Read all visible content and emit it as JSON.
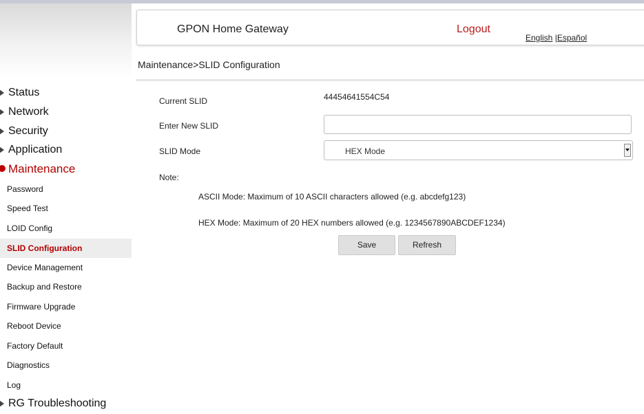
{
  "header": {
    "title": "GPON Home Gateway",
    "logout": "Logout",
    "lang_english": "English",
    "lang_separator": "|",
    "lang_spanish": "Español"
  },
  "breadcrumb": "Maintenance>SLID Configuration",
  "sidebar": {
    "categories": [
      {
        "label": "Status"
      },
      {
        "label": "Network"
      },
      {
        "label": "Security"
      },
      {
        "label": "Application"
      },
      {
        "label": "Maintenance",
        "active": true
      },
      {
        "label": "RG Troubleshooting"
      }
    ],
    "maintenance_items": [
      {
        "label": "Password"
      },
      {
        "label": "Speed Test"
      },
      {
        "label": "LOID Config"
      },
      {
        "label": "SLID Configuration",
        "selected": true
      },
      {
        "label": "Device Management"
      },
      {
        "label": "Backup and Restore"
      },
      {
        "label": "Firmware Upgrade"
      },
      {
        "label": "Reboot Device"
      },
      {
        "label": "Factory Default"
      },
      {
        "label": "Diagnostics"
      },
      {
        "label": "Log"
      }
    ]
  },
  "form": {
    "current_slid_label": "Current SLID",
    "current_slid_value": "44454641554C54",
    "new_slid_label": "Enter New SLID",
    "new_slid_value": "",
    "slid_mode_label": "SLID Mode",
    "slid_mode_value": "HEX Mode",
    "note_label": "Note:",
    "note_ascii": "ASCII Mode: Maximum of 10 ASCII characters allowed (e.g. abcdefg123)",
    "note_hex": "HEX Mode: Maximum of 20 HEX numbers allowed (e.g. 1234567890ABCDEF1234)"
  },
  "buttons": {
    "save": "Save",
    "refresh": "Refresh"
  },
  "colors": {
    "accent_red": "#b00000",
    "logout_red": "#b71c1c",
    "button_bg": "#e0e0e0"
  }
}
